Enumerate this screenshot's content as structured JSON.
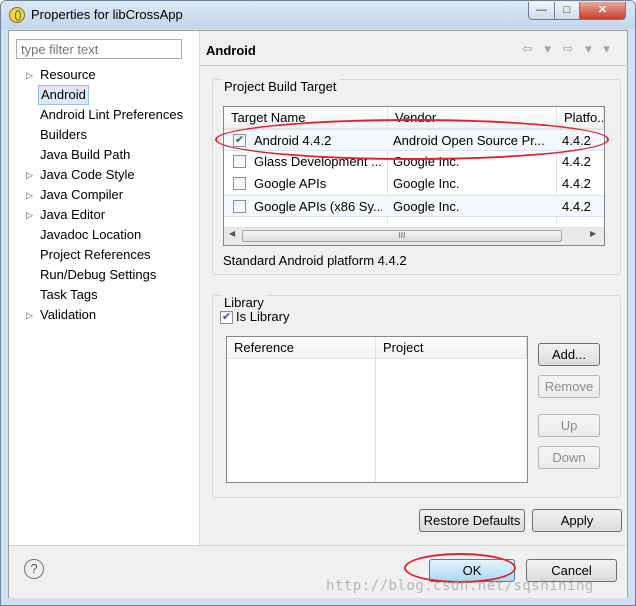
{
  "window": {
    "title": "Properties for libCrossApp",
    "minimize": "—",
    "maximize": "□",
    "close": "✕"
  },
  "sidebar": {
    "filter_placeholder": "type filter text",
    "items": [
      {
        "label": "Resource",
        "expandable": true
      },
      {
        "label": "Android",
        "expandable": false,
        "selected": true
      },
      {
        "label": "Android Lint Preferences",
        "expandable": false
      },
      {
        "label": "Builders",
        "expandable": false
      },
      {
        "label": "Java Build Path",
        "expandable": false
      },
      {
        "label": "Java Code Style",
        "expandable": true
      },
      {
        "label": "Java Compiler",
        "expandable": true
      },
      {
        "label": "Java Editor",
        "expandable": true
      },
      {
        "label": "Javadoc Location",
        "expandable": false
      },
      {
        "label": "Project References",
        "expandable": false
      },
      {
        "label": "Run/Debug Settings",
        "expandable": false
      },
      {
        "label": "Task Tags",
        "expandable": false
      },
      {
        "label": "Validation",
        "expandable": true
      }
    ]
  },
  "page": {
    "title": "Android",
    "nav": "⇦ ▾ ⇨ ▾ ▾"
  },
  "build_target": {
    "group_title": "Project Build Target",
    "columns": [
      "Target Name",
      "Vendor",
      "Platfo..."
    ],
    "rows": [
      {
        "name": "Android 4.4.2",
        "vendor": "Android Open Source Pr...",
        "platform": "4.4.2",
        "checked": true
      },
      {
        "name": "Glass Development ...",
        "vendor": "Google Inc.",
        "platform": "4.4.2",
        "checked": false
      },
      {
        "name": "Google APIs",
        "vendor": "Google Inc.",
        "platform": "4.4.2",
        "checked": false
      },
      {
        "name": "Google APIs (x86 Sy...",
        "vendor": "Google Inc.",
        "platform": "4.4.2",
        "checked": false
      }
    ],
    "description": "Standard Android platform 4.4.2",
    "scroll_left": "◀",
    "scroll_right": "▶",
    "scroll_grip": "III"
  },
  "library": {
    "group_title": "Library",
    "is_library_label": "Is Library",
    "is_library_checked": true,
    "columns": [
      "Reference",
      "Project"
    ],
    "buttons": {
      "add": "Add...",
      "remove": "Remove",
      "up": "Up",
      "down": "Down"
    }
  },
  "actions": {
    "restore_defaults": "Restore Defaults",
    "apply": "Apply",
    "ok": "OK",
    "cancel": "Cancel",
    "help": "?"
  },
  "watermark": "http://blog.csdn.net/sqshining",
  "colors": {
    "annotation_red": "#e0252b",
    "selection_bg": "#dde9f6"
  }
}
